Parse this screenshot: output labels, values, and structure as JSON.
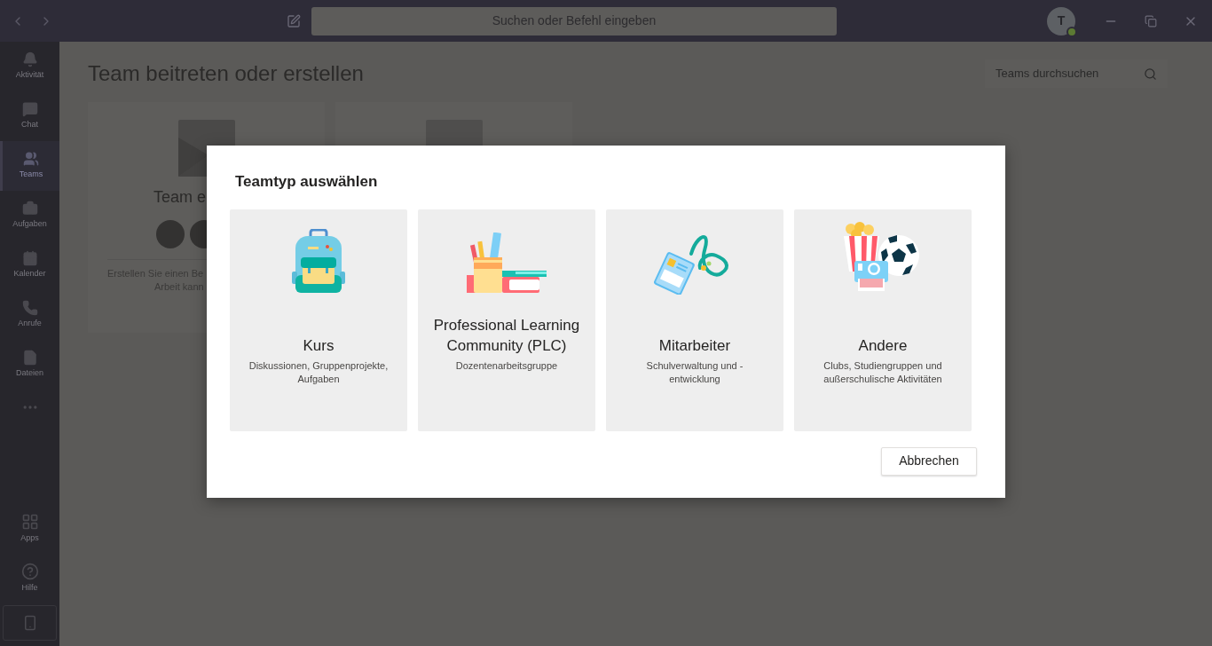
{
  "title_bar": {
    "search_placeholder": "Suchen oder Befehl eingeben",
    "avatar_initial": "T"
  },
  "sidebar": {
    "items": [
      {
        "kind": "bell",
        "label": "Aktivität",
        "selected": false
      },
      {
        "kind": "chat",
        "label": "Chat",
        "selected": false
      },
      {
        "kind": "teams",
        "label": "Teams",
        "selected": true
      },
      {
        "kind": "bag",
        "label": "Aufgaben",
        "selected": false
      },
      {
        "kind": "calendar",
        "label": "Kalender",
        "selected": false
      },
      {
        "kind": "phone",
        "label": "Anrufe",
        "selected": false
      },
      {
        "kind": "file",
        "label": "Dateien",
        "selected": false
      }
    ],
    "bottom_items": [
      {
        "kind": "apps",
        "label": "Apps"
      },
      {
        "kind": "help",
        "label": "Hilfe"
      }
    ]
  },
  "page": {
    "title": "Team beitreten oder erstellen",
    "search_placeholder": "Teams durchsuchen",
    "cards": [
      {
        "title": "Team e",
        "description_lines": [
          "Erstellen Sie einen Be",
          "Arbeit kann"
        ]
      }
    ]
  },
  "dialog": {
    "title": "Teamtyp auswählen",
    "options": [
      {
        "kind": "backpack",
        "title": "Kurs",
        "description": "Diskussionen, Gruppenprojekte, Aufgaben"
      },
      {
        "kind": "stationery",
        "title": "Professional Learning Community (PLC)",
        "description": "Dozentenarbeitsgruppe"
      },
      {
        "kind": "badge",
        "title": "Mitarbeiter",
        "description": "Schulverwaltung und - entwicklung"
      },
      {
        "kind": "leisure",
        "title": "Andere",
        "description": "Clubs, Studiengruppen und außerschulische Aktivitäten"
      }
    ],
    "cancel_label": "Abbrechen"
  }
}
